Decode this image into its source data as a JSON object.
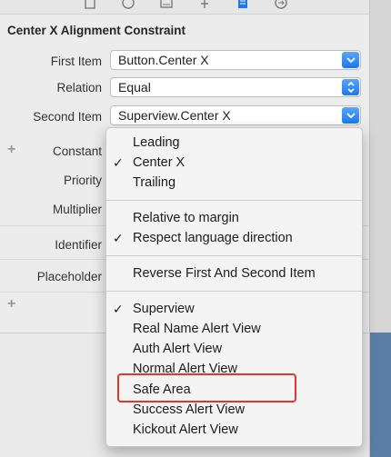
{
  "section_title": "Center X Alignment Constraint",
  "rows": {
    "first_item": {
      "label": "First Item",
      "value": "Button.Center X"
    },
    "relation": {
      "label": "Relation",
      "value": "Equal"
    },
    "second_item": {
      "label": "Second Item",
      "value": "Superview.Center X"
    },
    "constant": {
      "label": "Constant"
    },
    "priority": {
      "label": "Priority"
    },
    "multiplier": {
      "label": "Multiplier"
    },
    "identifier": {
      "label": "Identifier"
    },
    "placeholder": {
      "label": "Placeholder"
    }
  },
  "plus_symbol": "+",
  "menu": {
    "group1": [
      "Leading",
      "Center X",
      "Trailing"
    ],
    "group2": [
      "Relative to margin",
      "Respect language direction"
    ],
    "group3": [
      "Reverse First And Second Item"
    ],
    "group4": [
      "Superview",
      "Real Name Alert View",
      "Auth Alert View",
      "Normal Alert View",
      "Safe Area",
      "Success Alert View",
      "Kickout Alert View"
    ],
    "checkmark": "✓"
  },
  "colors": {
    "accent": "#1a79ec",
    "highlight_box": "#e5342a"
  },
  "icons": [
    "file-icon",
    "help-icon",
    "identity-icon",
    "attributes-icon",
    "size-inspector-icon",
    "connections-icon"
  ]
}
